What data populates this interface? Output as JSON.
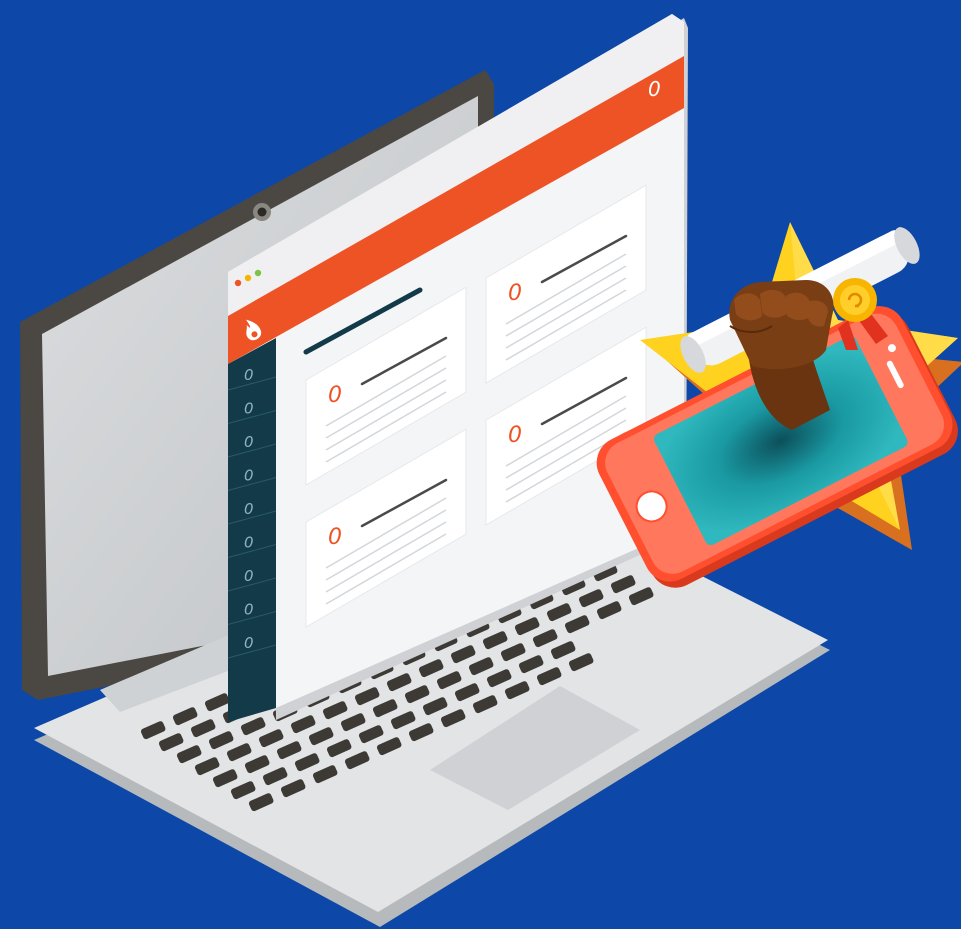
{
  "scene": {
    "background_color": "#0d47a8",
    "laptop": {
      "body_color": "#e2e4e6",
      "bezel_color": "#4b4743",
      "screen_color": "#cfd1d3",
      "key_color": "#3d3a36"
    },
    "browser_window": {
      "header_color": "#ee5325",
      "sidebar_color": "#123a48",
      "traffic_lights": [
        "#ee5325",
        "#f4b400",
        "#7cc243"
      ],
      "header_icon_glyph": "0",
      "logo_icon": "flame-icon",
      "sidebar_icon_glyphs": [
        "0",
        "0",
        "0",
        "0",
        "0",
        "0",
        "0",
        "0",
        "0"
      ],
      "cards": [
        {
          "icon_glyph": "0"
        },
        {
          "icon_glyph": "0"
        },
        {
          "icon_glyph": "0"
        },
        {
          "icon_glyph": "0"
        },
        {
          "icon_glyph": "0"
        }
      ]
    },
    "award_badge": {
      "star_color": "#ffd21f",
      "phone_frame_color": "#ff4f2e",
      "phone_screen_color": "#17838e",
      "diploma_icon": "diploma-icon",
      "seal_icon": "ribbon-seal-icon",
      "hand_icon": "raised-fist-icon"
    }
  }
}
